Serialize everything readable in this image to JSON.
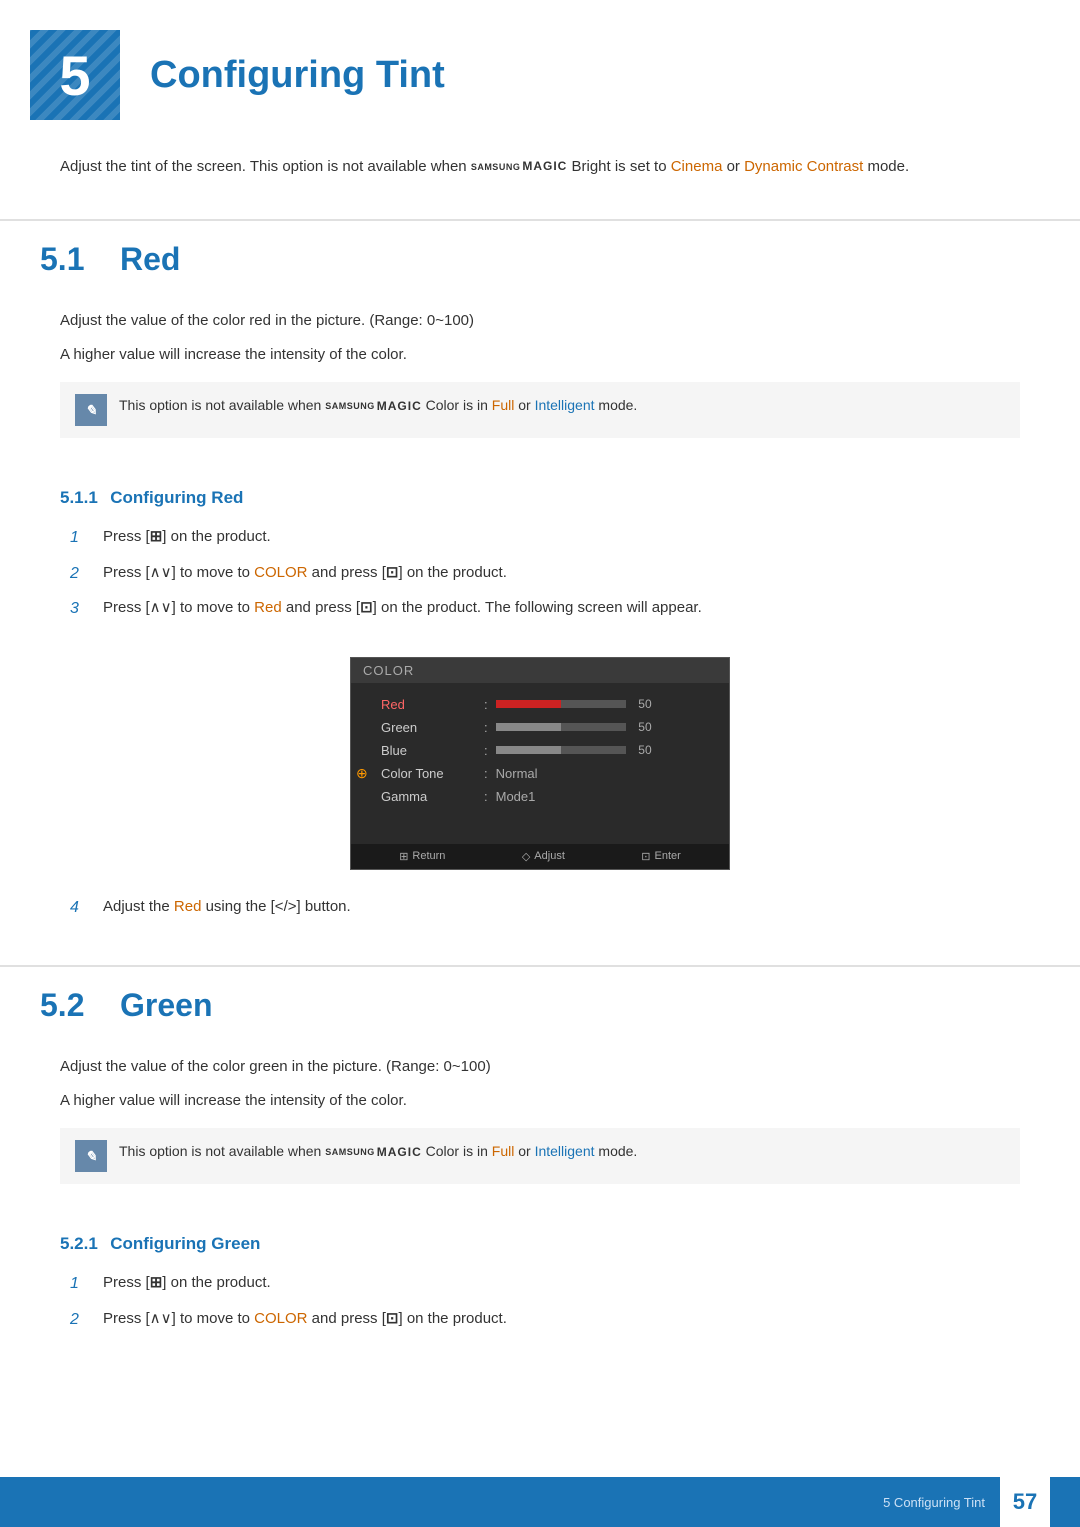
{
  "chapter": {
    "number": "5",
    "title": "Configuring Tint",
    "intro": "Adjust the tint of the screen. This option is not available when ",
    "intro_mid": "Bright is set to ",
    "intro_highlight1": "Cinema",
    "intro_mid2": " or ",
    "intro_highlight2": "Dynamic Contrast",
    "intro_end": " mode."
  },
  "section51": {
    "num": "5.1",
    "title": "Red",
    "para1": "Adjust the value of the color red in the picture. (Range: 0~100)",
    "para2": "A higher value will increase the intensity of the color.",
    "note": "This option is not available when ",
    "note_mid": "Color is in ",
    "note_highlight1": "Full",
    "note_mid2": " or ",
    "note_highlight2": "Intelligent",
    "note_end": " mode."
  },
  "subsection511": {
    "num": "5.1.1",
    "title": "Configuring Red"
  },
  "steps511": [
    {
      "num": "1",
      "text": "Press [",
      "icon": "⊞",
      "text2": "] on the product."
    },
    {
      "num": "2",
      "text_before": "Press [∧∨] to move to ",
      "highlight": "COLOR",
      "text_after": " and press [",
      "icon": "⊡",
      "text_end": "] on the product."
    },
    {
      "num": "3",
      "text_before": "Press [∧∨] to move to ",
      "highlight": "Red",
      "text_after": " and press [",
      "icon": "⊡",
      "text_end": "] on the product. The following screen will appear."
    },
    {
      "num": "4",
      "text_before": "Adjust the ",
      "highlight": "Red",
      "text_after": " using the [</> ] button."
    }
  ],
  "osd511": {
    "title": "COLOR",
    "rows": [
      {
        "label": "Red",
        "type": "bar",
        "value": 50,
        "percent": 50,
        "active": true
      },
      {
        "label": "Green",
        "type": "bar",
        "value": 50,
        "percent": 50,
        "active": false
      },
      {
        "label": "Blue",
        "type": "bar",
        "value": 50,
        "percent": 50,
        "active": false
      },
      {
        "label": "Color Tone",
        "type": "text",
        "value": "Normal",
        "active": false
      },
      {
        "label": "Gamma",
        "type": "text",
        "value": "Mode1",
        "active": false
      }
    ],
    "footer": [
      {
        "icon": "⊞",
        "label": "Return"
      },
      {
        "icon": "◇",
        "label": "Adjust"
      },
      {
        "icon": "⊡",
        "label": "Enter"
      }
    ]
  },
  "section52": {
    "num": "5.2",
    "title": "Green",
    "para1": "Adjust the value of the color green in the picture. (Range: 0~100)",
    "para2": "A higher value will increase the intensity of the color.",
    "note": "This option is not available when ",
    "note_mid": "Color is in ",
    "note_highlight1": "Full",
    "note_mid2": " or ",
    "note_highlight2": "Intelligent",
    "note_end": " mode."
  },
  "subsection521": {
    "num": "5.2.1",
    "title": "Configuring Green"
  },
  "steps521": [
    {
      "num": "1",
      "text": "Press [⊞] on the product."
    },
    {
      "num": "2",
      "text_before": "Press [∧∨] to move to ",
      "highlight": "COLOR",
      "text_after": " and press [⊡] on the product."
    }
  ],
  "footer": {
    "text": "5 Configuring Tint",
    "page": "57"
  }
}
